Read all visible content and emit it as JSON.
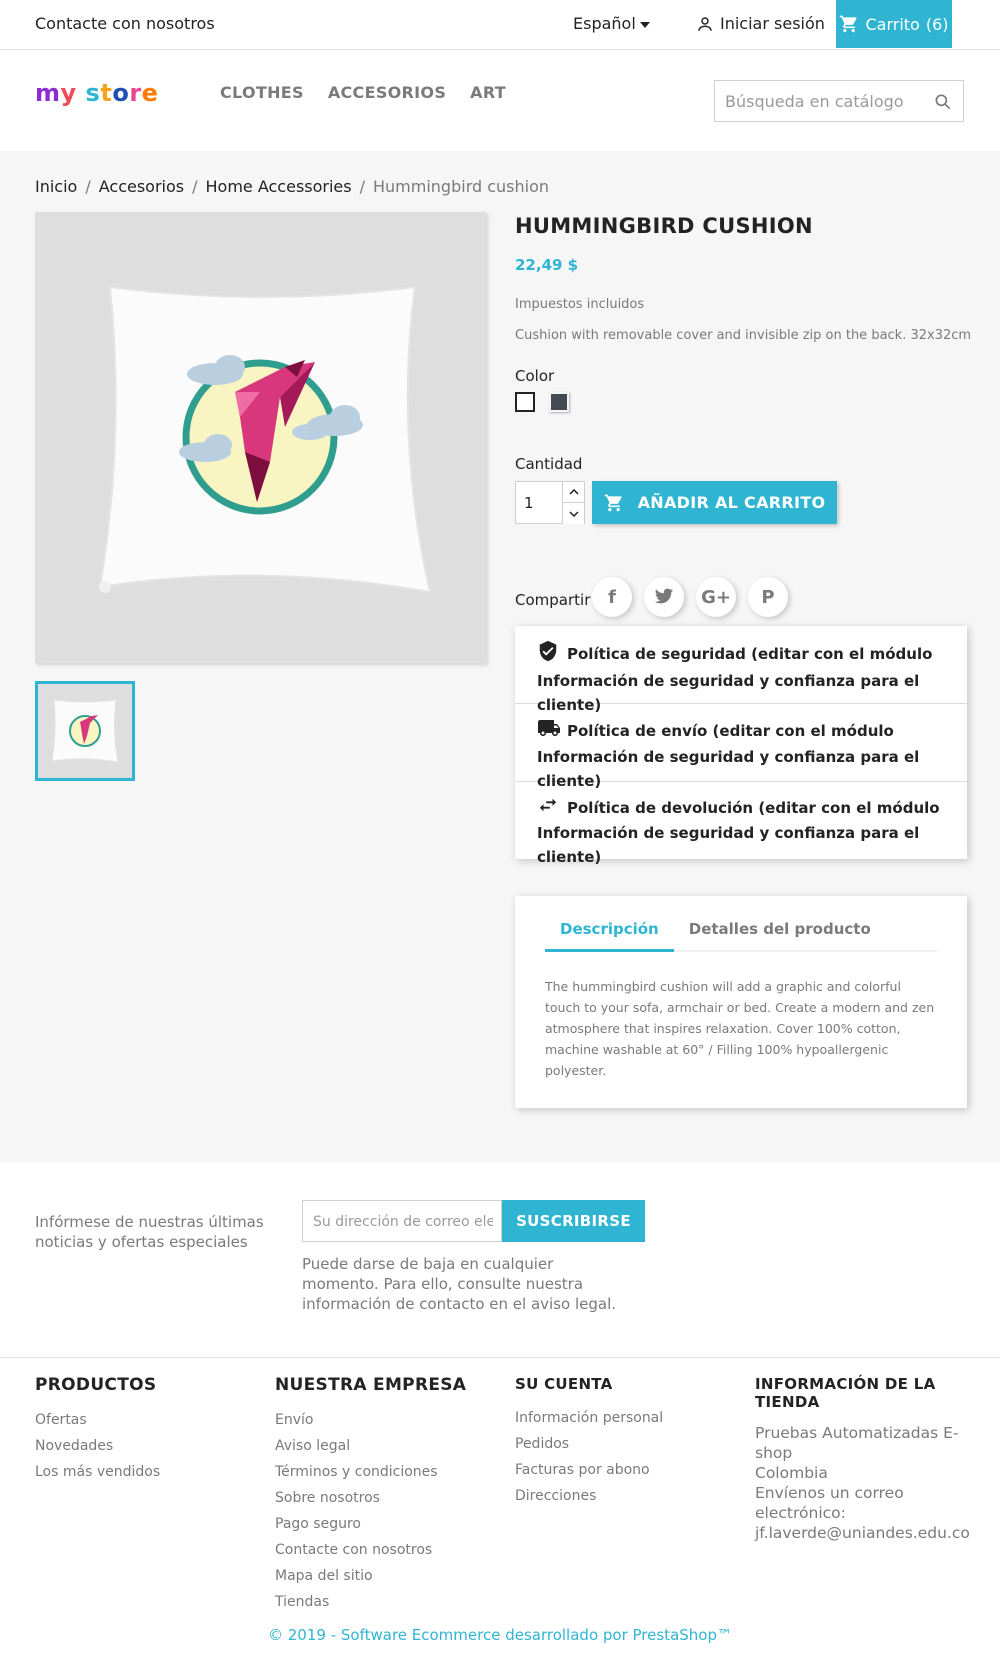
{
  "topbar": {
    "contact_label": "Contacte con nosotros",
    "language_label": "Español",
    "signin_label": "Iniciar sesión",
    "cart_label": "Carrito",
    "cart_count": "(6)"
  },
  "header": {
    "logo_text": "my store",
    "nav": [
      "CLOTHES",
      "ACCESORIOS",
      "ART"
    ],
    "search_placeholder": "Búsqueda en catálogo"
  },
  "breadcrumb": [
    "Inicio",
    "Accesorios",
    "Home Accessories",
    "Hummingbird cushion"
  ],
  "product": {
    "title": "HUMMINGBIRD CUSHION",
    "price": "22,49 $",
    "tax_note": "Impuestos incluidos",
    "short_description": "Cushion with removable cover and invisible zip on the back. 32x32cm",
    "color_label": "Color",
    "colors": [
      "#ffffff",
      "#434a54"
    ],
    "quantity_label": "Cantidad",
    "quantity_value": "1",
    "add_to_cart_label": "AÑADIR AL CARRITO",
    "share_label": "Compartir",
    "share_networks": [
      "f",
      "t",
      "G+",
      "P"
    ]
  },
  "reassurance": [
    "Política de seguridad (editar con el módulo Información de seguridad y confianza para el cliente)",
    "Política de envío (editar con el módulo Información de seguridad y confianza para el cliente)",
    "Política de devolución (editar con el módulo Información de seguridad y confianza para el cliente)"
  ],
  "tabs": {
    "labels": [
      "Descripción",
      "Detalles del producto"
    ],
    "active": 0,
    "description": "The hummingbird cushion will add a graphic and colorful touch to your sofa, armchair or bed. Create a modern and zen atmosphere that inspires relaxation. Cover 100% cotton, machine washable at 60° / Filling 100% hypoallergenic polyester."
  },
  "newsletter": {
    "intro": "Infórmese de nuestras últimas noticias y ofertas especiales",
    "email_placeholder": "Su dirección de correo electrónico",
    "subscribe_label": "SUSCRIBIRSE",
    "legal": "Puede darse de baja en cualquier momento. Para ello, consulte nuestra información de contacto en el aviso legal."
  },
  "footer": {
    "products": {
      "title": "PRODUCTOS",
      "items": [
        "Ofertas",
        "Novedades",
        "Los más vendidos"
      ]
    },
    "company": {
      "title": "NUESTRA EMPRESA",
      "items": [
        "Envío",
        "Aviso legal",
        "Términos y condiciones",
        "Sobre nosotros",
        "Pago seguro",
        "Contacte con nosotros",
        "Mapa del sitio",
        "Tiendas"
      ]
    },
    "account": {
      "title": "SU CUENTA",
      "items": [
        "Información personal",
        "Pedidos",
        "Facturas por abono",
        "Direcciones"
      ]
    },
    "store_info": {
      "title": "INFORMACIÓN DE LA TIENDA",
      "lines": [
        "Pruebas Automatizadas E-shop",
        "Colombia",
        "Envíenos un correo electrónico:",
        "jf.laverde@uniandes.edu.co"
      ]
    },
    "copyright": "© 2019 - Software Ecommerce desarrollado por PrestaShop™"
  },
  "colors": {
    "accent": "#2fb5d2",
    "text": "#232323",
    "muted": "#7a7a7a",
    "page_bg": "#f6f6f6"
  }
}
